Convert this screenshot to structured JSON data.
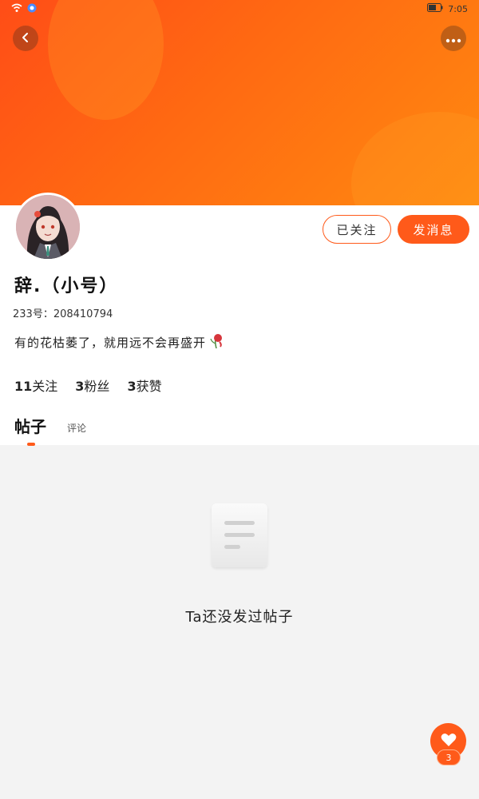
{
  "status_bar": {
    "time": "7:05",
    "icons": [
      "wifi-icon",
      "app-icon",
      "battery-icon"
    ]
  },
  "header": {
    "back_icon": "chevron-left-icon",
    "more_icon": "more-horizontal-icon"
  },
  "profile": {
    "username": "辞.（小号）",
    "uid": "233号：208410794",
    "bio": "有的花枯萎了，就用远不会再盛开",
    "bio_emoji": "wilted-rose-icon",
    "follow_button": "已关注",
    "message_button": "发消息"
  },
  "stats": {
    "following_count": "11",
    "following_label": "关注",
    "fans_count": "3",
    "fans_label": "粉丝",
    "likes_count": "3",
    "likes_label": "获赞"
  },
  "tabs": {
    "posts": "帖子",
    "comments": "评论"
  },
  "empty_state": {
    "text": "Ta还没发过帖子",
    "icon": "document-icon"
  },
  "like_fab": {
    "count": "3",
    "icon": "heart-icon"
  },
  "colors": {
    "accent": "#ff5a1a",
    "banner_start": "#ff4d17",
    "banner_end": "#ff8a10",
    "background": "#f3f3f3"
  }
}
